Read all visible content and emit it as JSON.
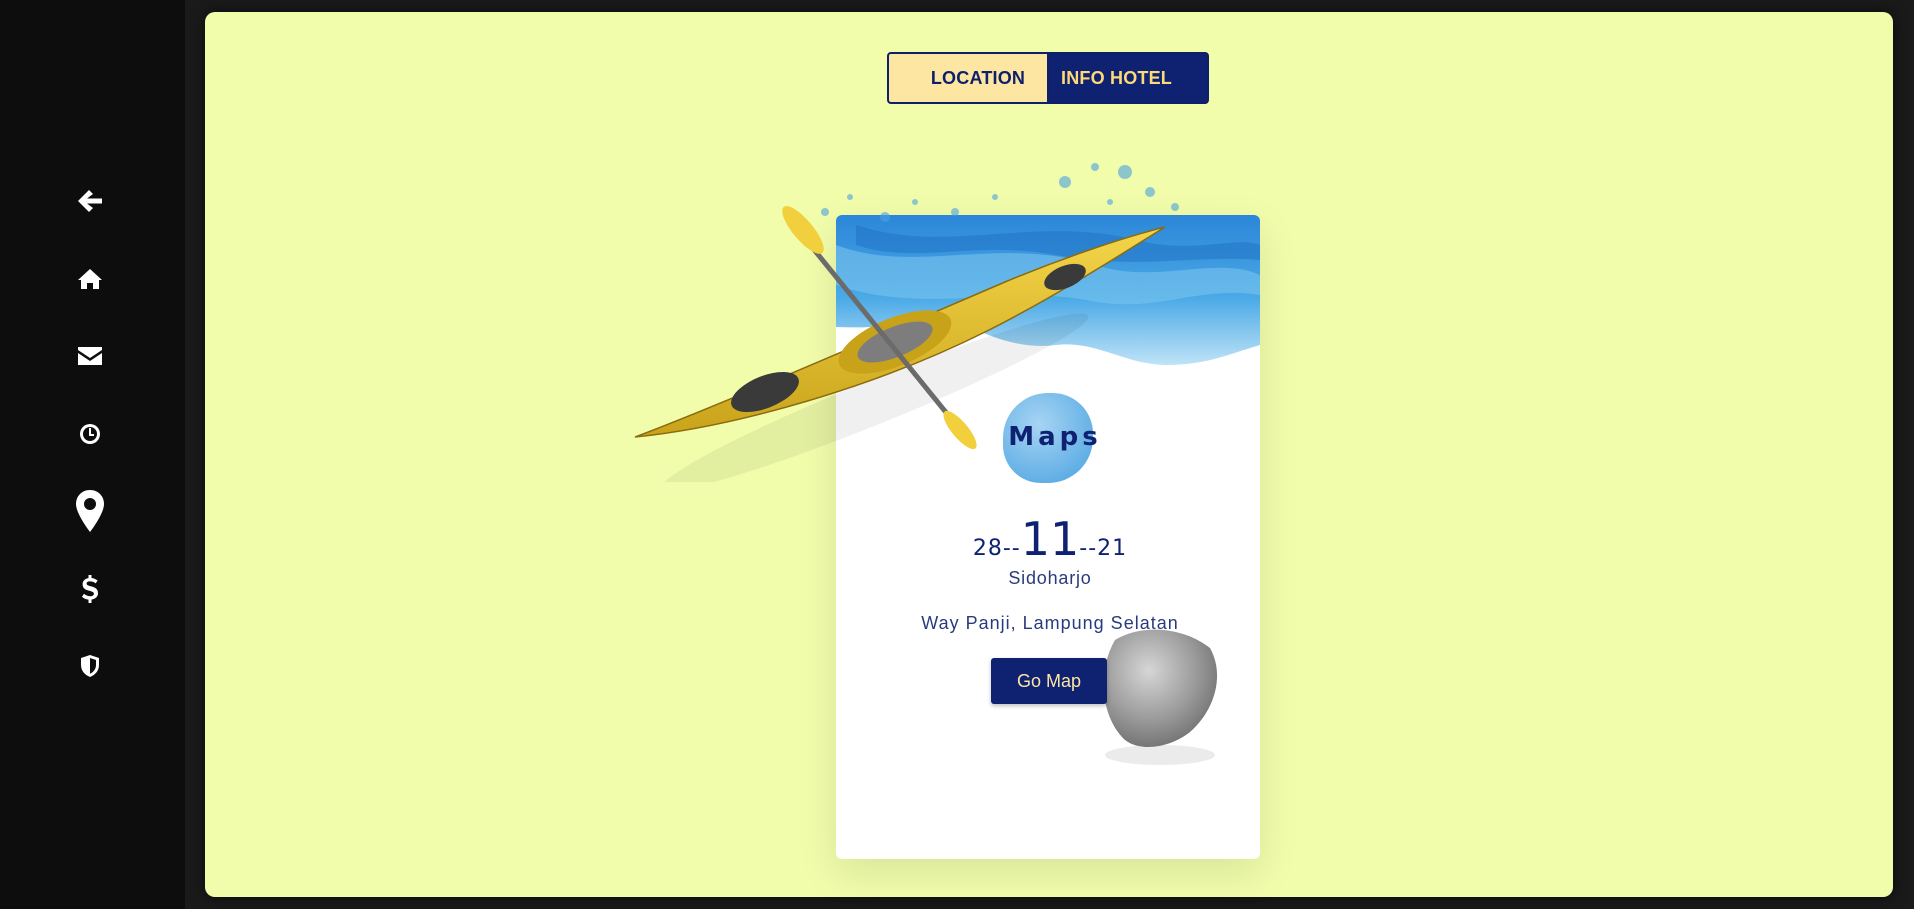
{
  "sidebar": {
    "items": [
      {
        "icon": "arrow-left-icon"
      },
      {
        "icon": "home-icon"
      },
      {
        "icon": "envelope-icon"
      },
      {
        "icon": "clock-icon"
      },
      {
        "icon": "map-marker-icon"
      },
      {
        "icon": "dollar-icon"
      },
      {
        "icon": "shield-icon"
      }
    ]
  },
  "tabs": {
    "location_label": "LOCATION",
    "hotel_label": "INFO HOTEL",
    "active": "LOCATION"
  },
  "card": {
    "title": "Maps",
    "date": {
      "day": "28--",
      "month": "11",
      "year": "--21"
    },
    "city": "Sidoharjo",
    "address": "Way Panji, Lampung Selatan",
    "button_label": "Go Map"
  },
  "colors": {
    "background": "#f1fdab",
    "sidebar": "#0d0d0d",
    "navy": "#0f2272",
    "cream": "#fde6a2"
  }
}
